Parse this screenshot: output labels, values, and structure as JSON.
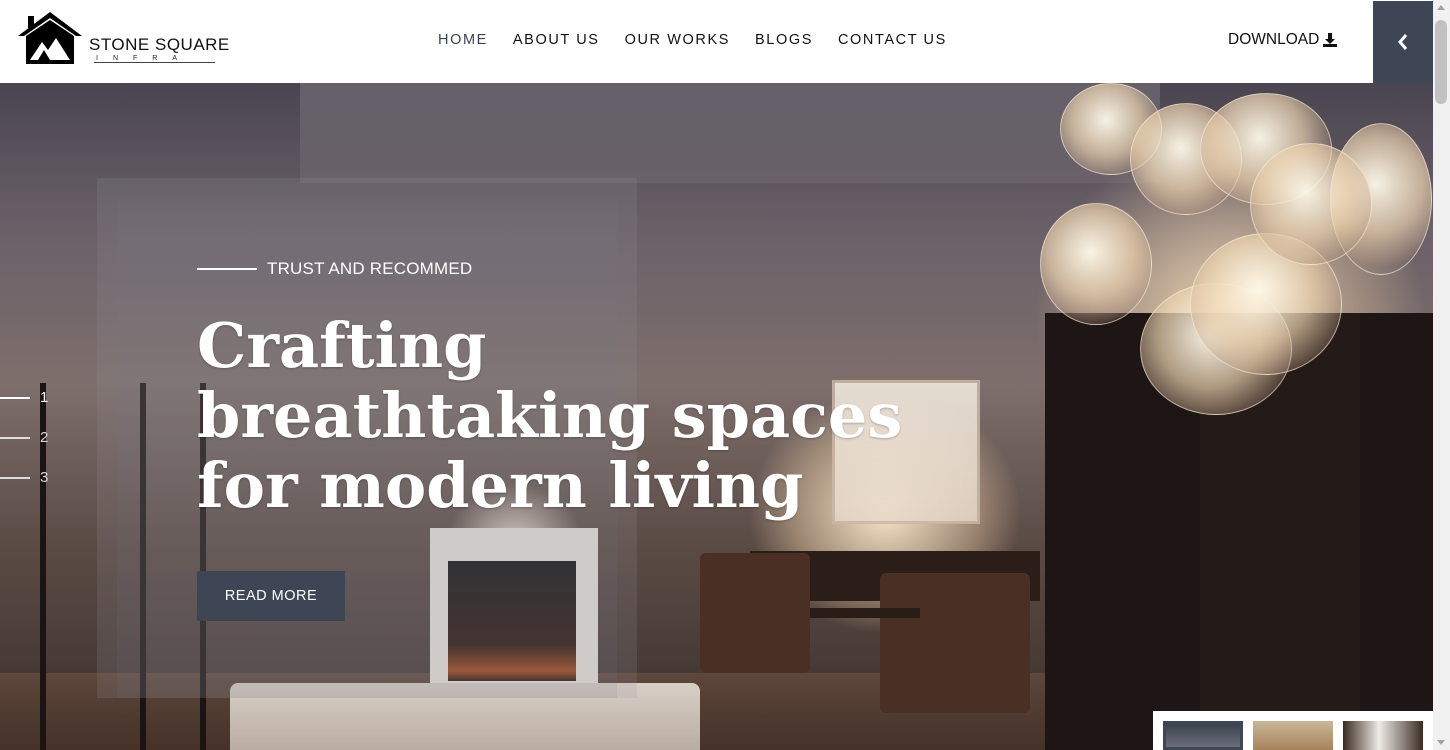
{
  "brand": {
    "name": "STONE SQUARE",
    "tagline": "INFRA"
  },
  "nav": {
    "items": [
      {
        "label": "HOME",
        "active": true
      },
      {
        "label": "ABOUT US",
        "active": false
      },
      {
        "label": "OUR WORKS",
        "active": false
      },
      {
        "label": "BLOGS",
        "active": false
      },
      {
        "label": "CONTACT US",
        "active": false
      }
    ],
    "download_label": "DOWNLOAD",
    "download_icon": "download-icon",
    "toggle_icon": "chevron-left-icon"
  },
  "hero": {
    "eyebrow": "TRUST AND RECOMMED",
    "headline": "Crafting breathtaking spaces for modern living",
    "cta_label": "READ MORE",
    "slides": [
      "1",
      "2",
      "3"
    ],
    "active_slide": "1"
  },
  "colors": {
    "accent": "#3e4655",
    "text": "#111111",
    "hero_text": "#ffffff"
  }
}
